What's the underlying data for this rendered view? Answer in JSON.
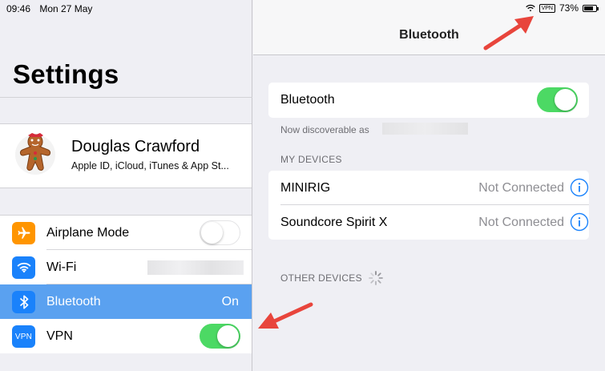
{
  "status": {
    "time": "09:46",
    "date": "Mon 27 May",
    "vpn": "VPN",
    "battery": "73%"
  },
  "settings": {
    "title": "Settings",
    "profile": {
      "name": "Douglas Crawford",
      "subtitle": "Apple ID, iCloud, iTunes & App St..."
    },
    "rows": [
      {
        "label": "Airplane Mode",
        "icon": "airplane-icon",
        "color": "#ff9500"
      },
      {
        "label": "Wi-Fi",
        "icon": "wifi-icon",
        "color": "#1a82fb"
      },
      {
        "label": "Bluetooth",
        "icon": "bluetooth-icon",
        "color": "#1a82fb",
        "value": "On"
      },
      {
        "label": "VPN",
        "icon": "vpn-icon",
        "color": "#1a82fb",
        "icon_text": "VPN"
      }
    ]
  },
  "bluetooth": {
    "nav_title": "Bluetooth",
    "toggle_label": "Bluetooth",
    "discoverable": "Now discoverable as",
    "my_devices_header": "MY DEVICES",
    "devices": [
      {
        "name": "MINIRIG",
        "status": "Not Connected"
      },
      {
        "name": "Soundcore Spirit X",
        "status": "Not Connected"
      }
    ],
    "other_devices_header": "OTHER DEVICES"
  },
  "colors": {
    "accent": "#1a82fb",
    "selected": "#5aa1f0",
    "toggle_on": "#4cd964",
    "arrow": "#e8453c"
  }
}
